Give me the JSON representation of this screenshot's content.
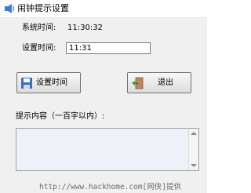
{
  "window": {
    "title": "闹钟提示设置"
  },
  "system_time": {
    "label": "系统时间:",
    "value": "11:30:32"
  },
  "set_time": {
    "label": "设置时间:",
    "value": "11:31"
  },
  "buttons": {
    "set_label": "设置时间",
    "exit_label": "退出"
  },
  "message": {
    "label": "提示内容（一百字以内）:",
    "value": ""
  },
  "watermark": "http://www.hackhome.com[网侠]提供",
  "icons": {
    "title": "speaker-icon",
    "set": "save-icon",
    "exit": "exit-door-icon"
  }
}
